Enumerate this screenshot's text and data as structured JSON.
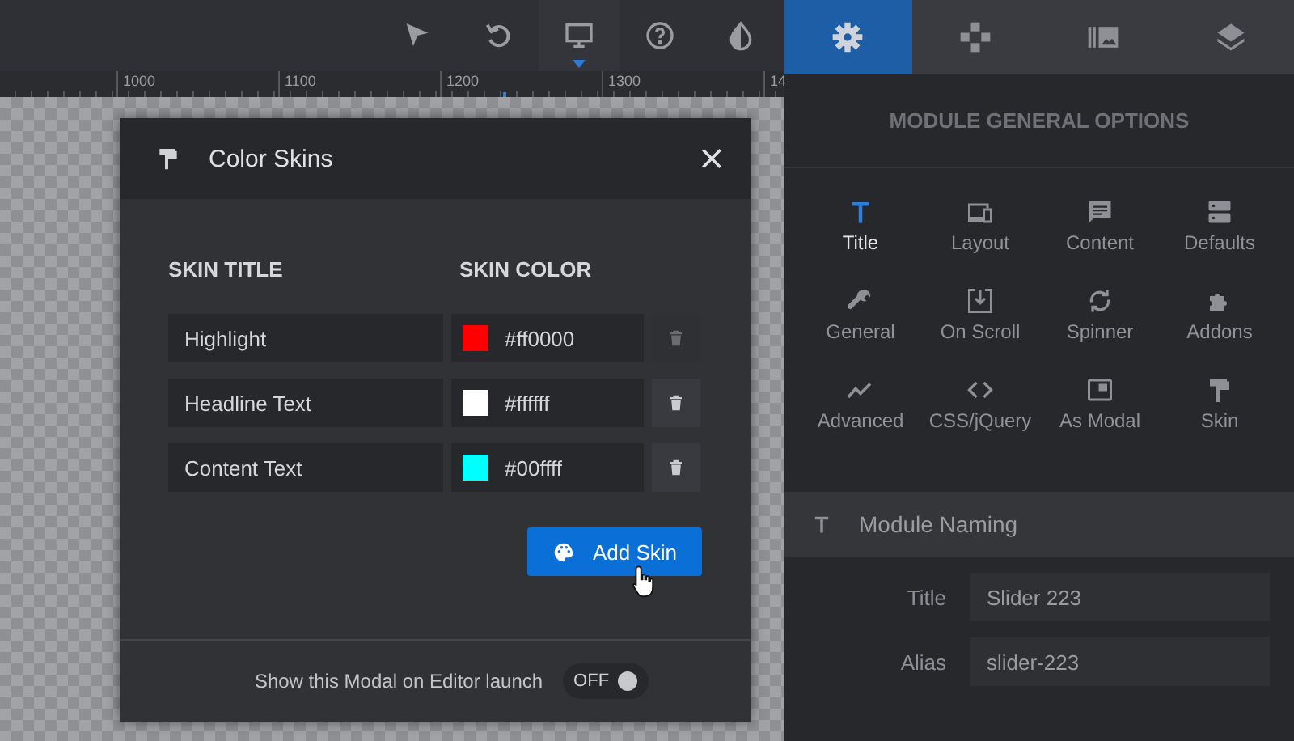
{
  "toolbar": {
    "tools": [
      {
        "kind": "pointer",
        "selected": false
      },
      {
        "kind": "undo",
        "selected": false
      },
      {
        "kind": "monitor",
        "selected": true
      },
      {
        "kind": "help",
        "selected": false
      },
      {
        "kind": "contrast",
        "selected": false
      }
    ]
  },
  "ruler": {
    "labels": [
      "1000",
      "1100",
      "1200",
      "1300",
      "14"
    ]
  },
  "modal": {
    "title": "Color Skins",
    "columns": [
      "SKIN TITLE",
      "SKIN COLOR"
    ],
    "skins": [
      {
        "title": "Highlight",
        "color": "#ff0000",
        "hex": "#ff0000",
        "delete_disabled": true
      },
      {
        "title": "Headline Text",
        "color": "#ffffff",
        "hex": "#ffffff",
        "delete_disabled": false
      },
      {
        "title": "Content Text",
        "color": "#00ffff",
        "hex": "#00ffff",
        "delete_disabled": false
      }
    ],
    "add_button": "Add Skin",
    "footer": {
      "label": "Show this Modal on Editor launch",
      "toggle_text": "OFF",
      "on": false
    }
  },
  "panel": {
    "tabs": [
      {
        "kind": "settings",
        "selected": true
      },
      {
        "kind": "navigation",
        "selected": false
      },
      {
        "kind": "slides",
        "selected": false
      },
      {
        "kind": "layers",
        "selected": false
      }
    ],
    "heading": "MODULE GENERAL OPTIONS",
    "options": [
      {
        "kind": "title",
        "label": "Title",
        "selected": true
      },
      {
        "kind": "layout",
        "label": "Layout",
        "selected": false
      },
      {
        "kind": "content",
        "label": "Content",
        "selected": false
      },
      {
        "kind": "defaults",
        "label": "Defaults",
        "selected": false
      },
      {
        "kind": "general",
        "label": "General",
        "selected": false
      },
      {
        "kind": "scroll",
        "label": "On Scroll",
        "selected": false
      },
      {
        "kind": "spinner",
        "label": "Spinner",
        "selected": false
      },
      {
        "kind": "addons",
        "label": "Addons",
        "selected": false
      },
      {
        "kind": "advanced",
        "label": "Advanced",
        "selected": false
      },
      {
        "kind": "code",
        "label": "CSS/jQuery",
        "selected": false
      },
      {
        "kind": "modal",
        "label": "As Modal",
        "selected": false
      },
      {
        "kind": "skin",
        "label": "Skin",
        "selected": false
      }
    ],
    "section": "Module Naming",
    "fields": [
      {
        "label": "Title",
        "value": "Slider 223"
      },
      {
        "label": "Alias",
        "value": "slider-223"
      }
    ]
  }
}
